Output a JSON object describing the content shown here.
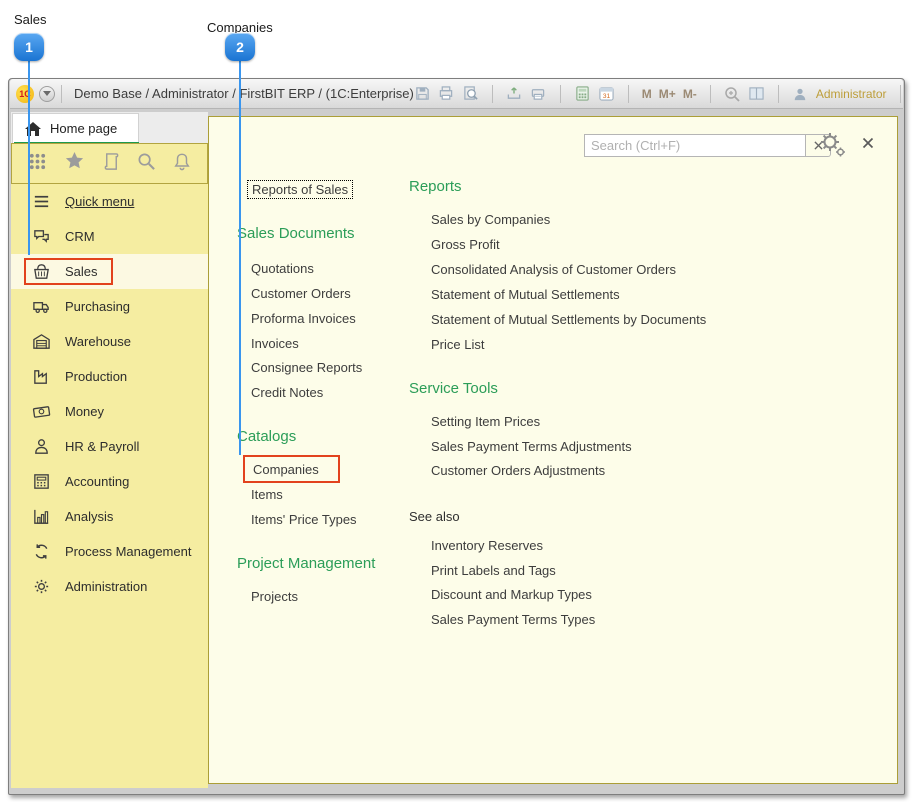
{
  "annotations": {
    "callout1": {
      "label": "Sales",
      "number": "1"
    },
    "callout2": {
      "label": "Companies",
      "number": "2"
    }
  },
  "window": {
    "title": "Demo Base / Administrator / FirstBIT ERP /  (1C:Enterprise)",
    "logo": "1C",
    "calendar_day": "31",
    "m": "M",
    "m_plus": "M+",
    "m_minus": "M-",
    "user": "Administrator",
    "tab": "Home page"
  },
  "panel": {
    "search_placeholder": "Search (Ctrl+F)",
    "left": {
      "focus_link": "Reports of Sales",
      "sections": [
        {
          "title": "Sales Documents",
          "items": [
            "Quotations",
            "Customer Orders",
            "Proforma Invoices",
            "Invoices",
            "Consignee Reports",
            "Credit Notes"
          ]
        },
        {
          "title": "Catalogs",
          "items": [
            "Companies",
            "Items",
            "Items' Price Types"
          ]
        },
        {
          "title": "Project Management",
          "items": [
            "Projects"
          ]
        }
      ]
    },
    "right": {
      "sections": [
        {
          "title": "Reports",
          "items": [
            "Sales by Companies",
            "Gross Profit",
            "Consolidated Analysis of Customer Orders",
            "Statement of Mutual Settlements",
            "Statement of Mutual Settlements by Documents",
            "Price List"
          ]
        },
        {
          "title": "Service Tools",
          "items": [
            "Setting Item Prices",
            "Sales Payment Terms Adjustments",
            "Customer Orders Adjustments"
          ]
        },
        {
          "title": "See also",
          "items": [
            "Inventory Reserves",
            "Print Labels and Tags",
            "Discount and Markup Types",
            "Sales Payment Terms Types"
          ]
        }
      ]
    }
  },
  "sidebar": {
    "items": [
      {
        "label": "Quick menu"
      },
      {
        "label": "CRM"
      },
      {
        "label": "Sales"
      },
      {
        "label": "Purchasing"
      },
      {
        "label": "Warehouse"
      },
      {
        "label": "Production"
      },
      {
        "label": "Money"
      },
      {
        "label": "HR & Payroll"
      },
      {
        "label": "Accounting"
      },
      {
        "label": "Analysis"
      },
      {
        "label": "Process Management"
      },
      {
        "label": "Administration"
      }
    ]
  },
  "colors": {
    "accent_green": "#2b9d58",
    "sidebar_yellow": "#f5eda1",
    "panel_yellow": "#fdfde9",
    "olive_border": "#ab9e37",
    "callout_blue": "#1a74d2",
    "highlight_red": "#e2421d"
  }
}
